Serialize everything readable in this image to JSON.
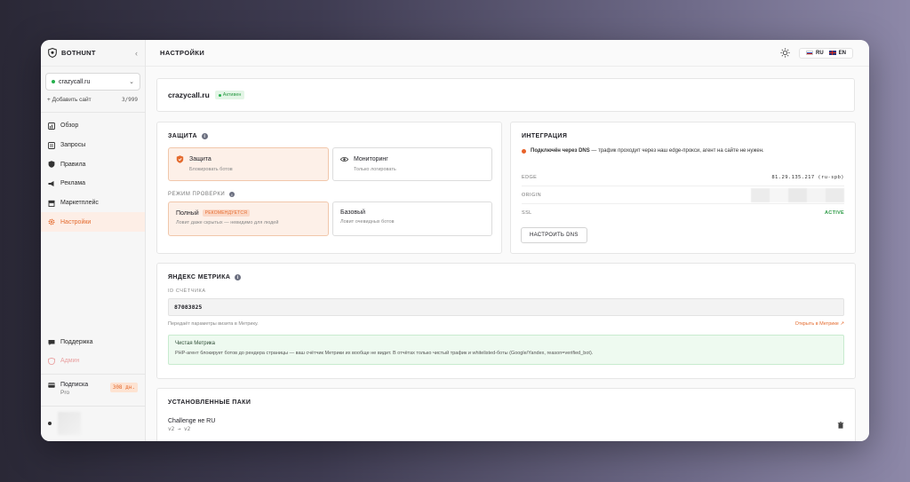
{
  "sidebar": {
    "brand": "BOTHUNT",
    "site_selector": {
      "value": "crazycall.ru"
    },
    "add_site": {
      "label": "+ Добавить сайт",
      "count": "3/999"
    },
    "nav": [
      {
        "label": "Обзор",
        "icon": "overview-icon"
      },
      {
        "label": "Запросы",
        "icon": "requests-icon"
      },
      {
        "label": "Правила",
        "icon": "rules-icon"
      },
      {
        "label": "Реклама",
        "icon": "ads-icon"
      },
      {
        "label": "Маркетплейс",
        "icon": "marketplace-icon"
      },
      {
        "label": "Настройки",
        "icon": "settings-icon",
        "active": true
      }
    ],
    "support": "Поддержка",
    "admin": "Админ",
    "subscription": {
      "label": "Подписка",
      "plan": "Pro",
      "days": "308 дн."
    }
  },
  "topbar": {
    "title": "НАСТРОЙКИ",
    "languages": [
      "RU",
      "EN"
    ]
  },
  "site_card": {
    "name": "crazycall.ru",
    "status": "Активен"
  },
  "protection": {
    "title": "ЗАЩИТА",
    "options": [
      {
        "title": "Защита",
        "subtitle": "Блокировать ботов",
        "selected": true
      },
      {
        "title": "Мониторинг",
        "subtitle": "Только логировать",
        "selected": false
      }
    ],
    "mode_label": "РЕЖИМ ПРОВЕРКИ",
    "modes": [
      {
        "title": "Полный",
        "badge": "РЕКОМЕНДУЕТСЯ",
        "subtitle": "Ловит даже скрытых — невидимо для людей",
        "selected": true
      },
      {
        "title": "Базовый",
        "subtitle": "Ловит очевидных ботов",
        "selected": false
      }
    ]
  },
  "integration": {
    "title": "ИНТЕГРАЦИЯ",
    "status_bold": "Подключён через DNS",
    "status_rest": " — трафик проходит через наш edge-прокси, агент на сайте не нужен.",
    "rows": [
      {
        "key": "EDGE",
        "value": "81.29.135.217 (ru-spb)"
      },
      {
        "key": "ORIGIN",
        "value": ""
      },
      {
        "key": "SSL",
        "value": "ACTIVE"
      }
    ],
    "button": "НАСТРОИТЬ DNS"
  },
  "metrika": {
    "title": "ЯНДЕКС МЕТРИКА",
    "id_label": "ID СЧЁТЧИКА",
    "id_value": "87083825",
    "hint": "Передаёт параметры визита в Метрику.",
    "open_link": "Открыть в Метрике ↗",
    "clean_title": "Чистая Метрика",
    "clean_desc": "PHP-агент блокирует ботов до рендера страницы — ваш счётчик Метрики их вообще не видит. В отчётах только чистый трафик и whitelisted-боты (Google/Yandex, reason=verified_bot)."
  },
  "packs": {
    "title": "УСТАНОВЛЕННЫЕ ПАКИ",
    "items": [
      {
        "name": "Challenge не RU",
        "version": "v2 → v2"
      }
    ]
  },
  "colors": {
    "accent": "#e46a2d",
    "success": "#25b04c",
    "selected_bg": "#fdf0e8"
  }
}
